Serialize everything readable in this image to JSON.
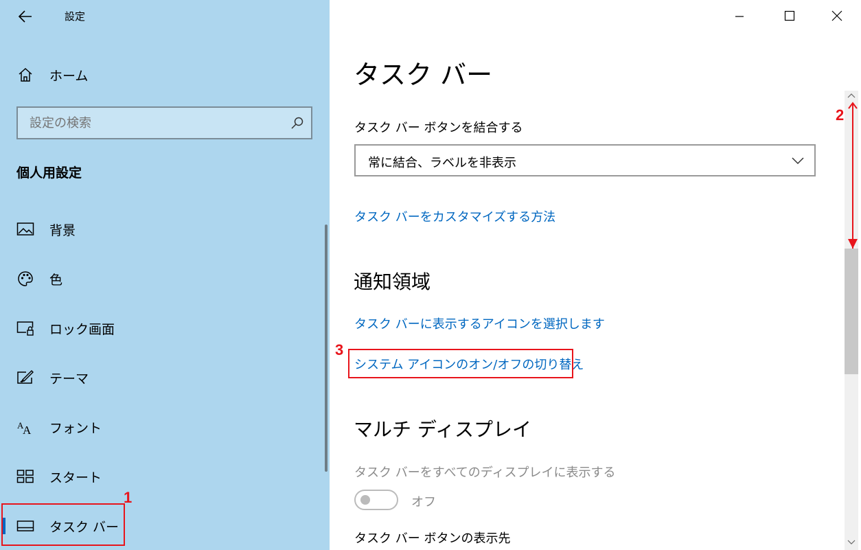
{
  "window": {
    "title": "設定",
    "controls": [
      "minimize-icon",
      "maximize-icon",
      "close-icon"
    ]
  },
  "sidebar": {
    "home_label": "ホーム",
    "search_placeholder": "設定の検索",
    "section_title": "個人用設定",
    "items": [
      {
        "label": "背景",
        "icon": "picture-icon"
      },
      {
        "label": "色",
        "icon": "palette-icon"
      },
      {
        "label": "ロック画面",
        "icon": "lock-screen-icon"
      },
      {
        "label": "テーマ",
        "icon": "theme-icon"
      },
      {
        "label": "フォント",
        "icon": "font-icon"
      },
      {
        "label": "スタート",
        "icon": "start-icon"
      },
      {
        "label": "タスク バー",
        "icon": "taskbar-icon",
        "selected": true
      }
    ]
  },
  "main": {
    "page_title": "タスク バー",
    "combine_label": "タスク バー ボタンを結合する",
    "combine_value": "常に結合、ラベルを非表示",
    "customize_link": "タスク バーをカスタマイズする方法",
    "notification_heading": "通知領域",
    "select_icons_link": "タスク バーに表示するアイコンを選択します",
    "system_icons_link": "システム アイコンのオン/オフの切り替え",
    "multi_display_heading": "マルチ ディスプレイ",
    "all_displays_label": "タスク バーをすべてのディスプレイに表示する",
    "toggle_state": "オフ",
    "buttons_display_label": "タスク バー ボタンの表示先"
  },
  "annotations": [
    "1",
    "2",
    "3"
  ],
  "colors": {
    "sidebar_bg": "#add6ee",
    "accent": "#0067c0",
    "annotation_red": "#e8141b"
  }
}
